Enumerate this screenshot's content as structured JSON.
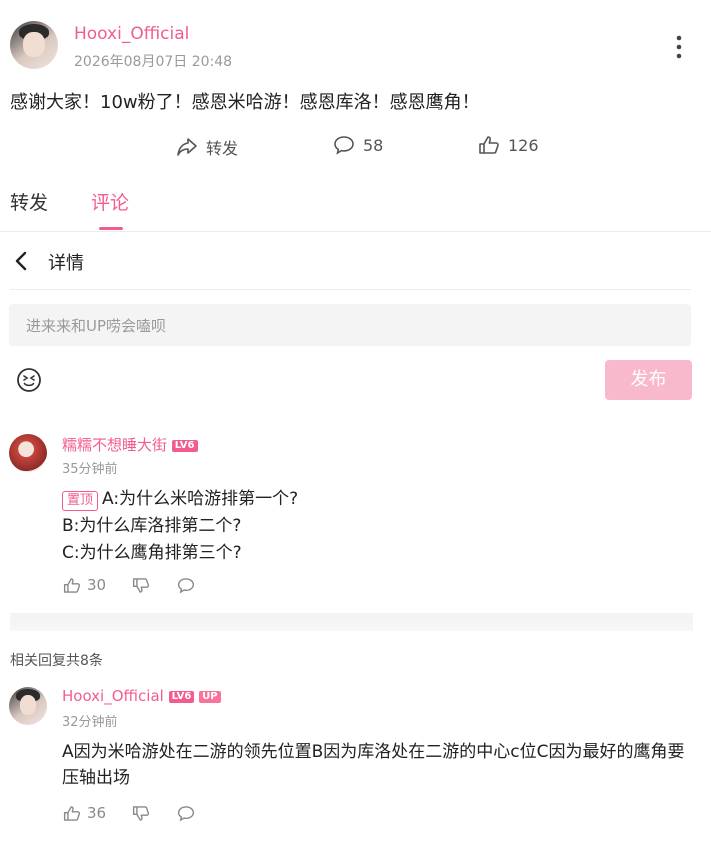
{
  "post": {
    "username": "Hooxi_Official",
    "timestamp": "2026年08月07日 20:48",
    "content": "感谢大家！10w粉了！感恩米哈游！感恩库洛！感恩鹰角！",
    "repost_label": "转发",
    "comment_count": "58",
    "like_count": "126"
  },
  "tabs": [
    {
      "label": "转发",
      "active": false
    },
    {
      "label": "评论",
      "active": true
    }
  ],
  "detail": {
    "title": "详情"
  },
  "comment_input": {
    "placeholder": "进来来和UP唠会嗑呗",
    "send_label": "发布"
  },
  "top_comment": {
    "username": "糯糯不想睡大街",
    "level": "LV6",
    "time": "35分钟前",
    "pinned_label": "置顶",
    "lines": [
      "A:为什么米哈游排第一个?",
      "B:为什么库洛排第二个?",
      "C:为什么鹰角排第三个?"
    ],
    "likes": "30"
  },
  "replies_header": "相关回复共8条",
  "reply": {
    "username": "Hooxi_Official",
    "level": "LV6",
    "up_badge": "UP",
    "time": "32分钟前",
    "text": "A因为米哈游处在二游的领先位置B因为库洛处在二游的中心c位C因为最好的鹰角要压轴出场",
    "likes": "36"
  },
  "colors": {
    "accent": "#f25d8e",
    "send_button": "#f9b9cd"
  }
}
